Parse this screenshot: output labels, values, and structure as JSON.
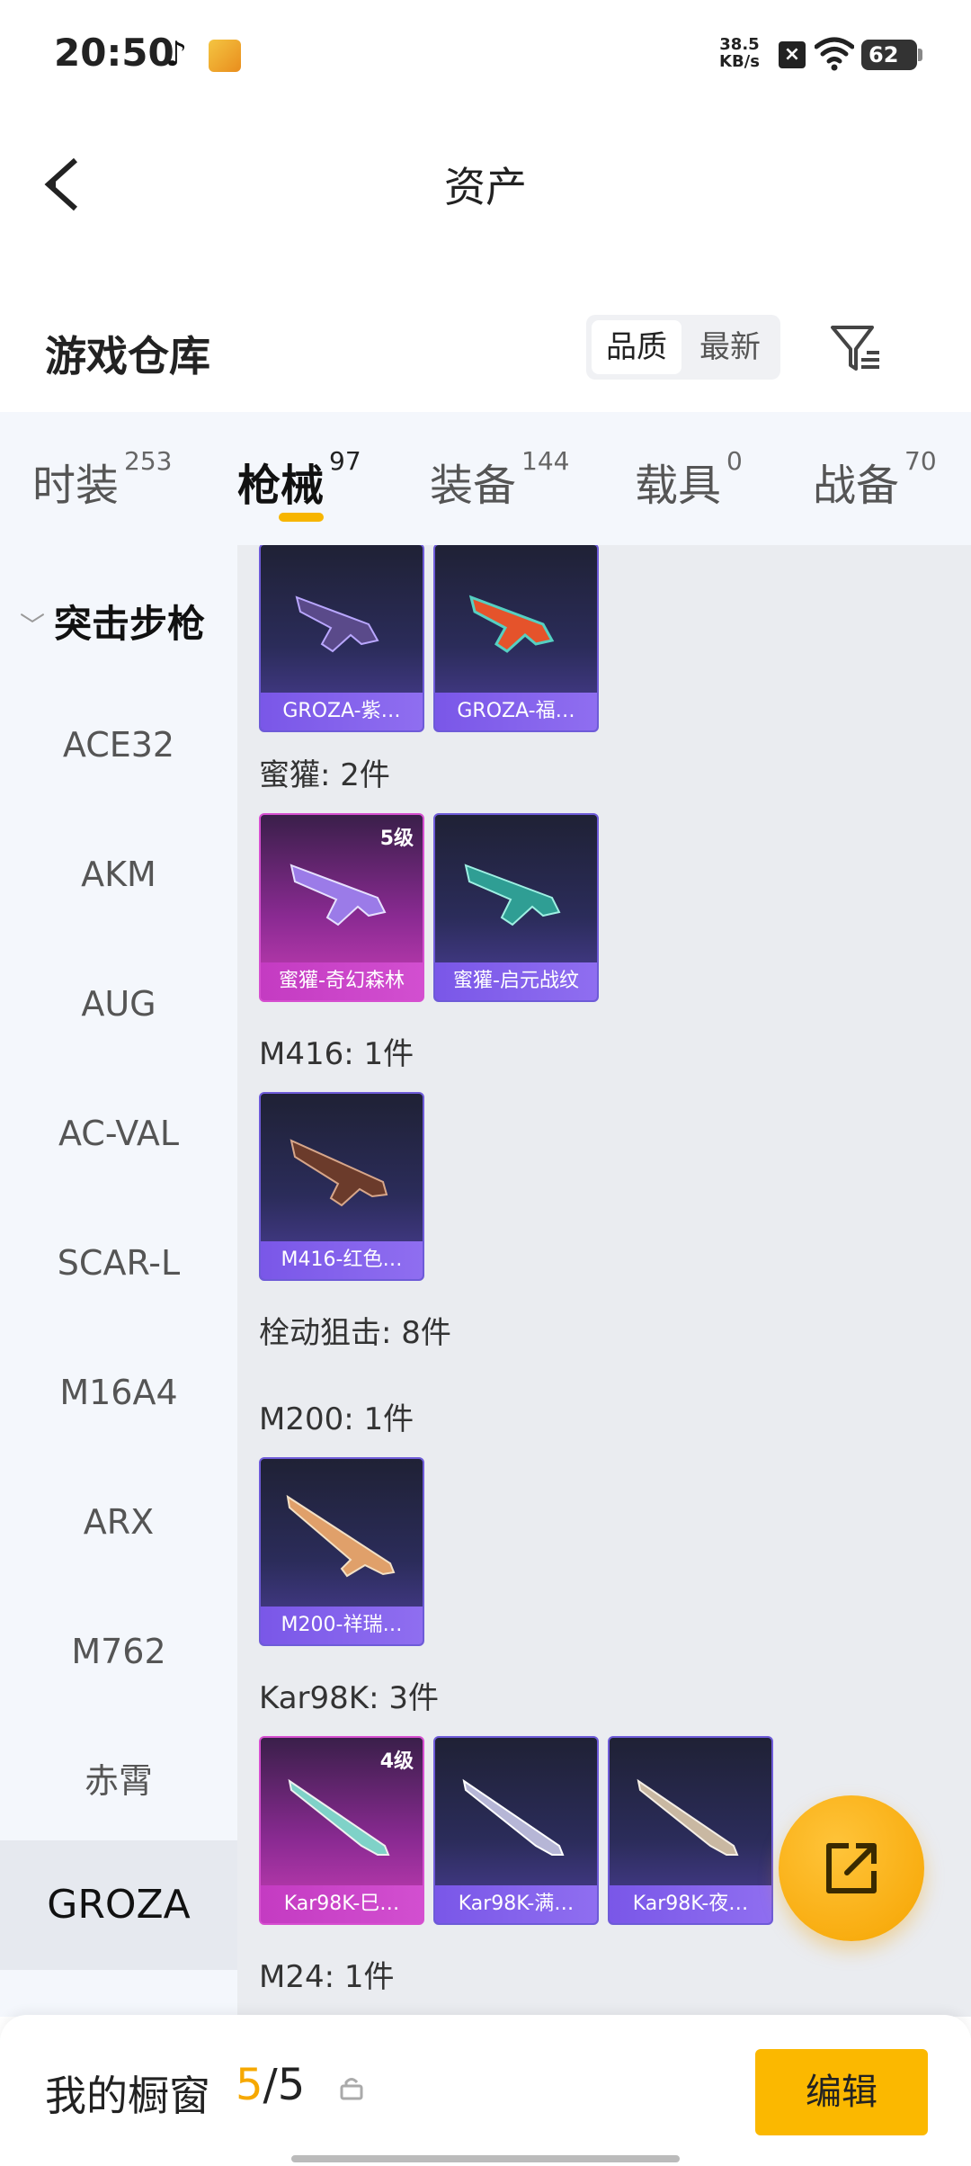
{
  "status": {
    "time": "20:50",
    "net_speed_value": "38.5",
    "net_speed_unit": "KB/s",
    "battery": "62"
  },
  "header": {
    "title": "资产"
  },
  "warehouse": {
    "title": "游戏仓库",
    "sort_options": [
      "品质",
      "最新"
    ]
  },
  "tabs": [
    {
      "label": "时装",
      "count": "253"
    },
    {
      "label": "枪械",
      "count": "97"
    },
    {
      "label": "装备",
      "count": "144"
    },
    {
      "label": "载具",
      "count": "0"
    },
    {
      "label": "战备",
      "count": "70"
    }
  ],
  "sidebar": {
    "group": "突击步枪",
    "items": [
      "ACE32",
      "AKM",
      "AUG",
      "AC-VAL",
      "SCAR-L",
      "M16A4",
      "ARX",
      "M762",
      "赤霄",
      "GROZA"
    ],
    "selected": "GROZA"
  },
  "content": {
    "sections": [
      {
        "title": "",
        "cards": [
          {
            "name": "GROZA-紫…",
            "level": "",
            "rarity": "purple"
          },
          {
            "name": "GROZA-福…",
            "level": "",
            "rarity": "purple"
          }
        ]
      },
      {
        "title": "蜜獾: 2件",
        "cards": [
          {
            "name": "蜜獾-奇幻森林",
            "level": "5级",
            "rarity": "pink"
          },
          {
            "name": "蜜獾-启元战纹",
            "level": "",
            "rarity": "purple"
          }
        ]
      },
      {
        "title": "M416: 1件",
        "cards": [
          {
            "name": "M416-红色…",
            "level": "",
            "rarity": "purple"
          }
        ]
      },
      {
        "title": "栓动狙击: 8件",
        "cards": []
      },
      {
        "title": "M200: 1件",
        "cards": [
          {
            "name": "M200-祥瑞…",
            "level": "",
            "rarity": "purple"
          }
        ]
      },
      {
        "title": "Kar98K: 3件",
        "cards": [
          {
            "name": "Kar98K-巳…",
            "level": "4级",
            "rarity": "pink"
          },
          {
            "name": "Kar98K-满…",
            "level": "",
            "rarity": "purple"
          },
          {
            "name": "Kar98K-夜…",
            "level": "",
            "rarity": "purple"
          }
        ]
      },
      {
        "title": "M24: 1件",
        "cards": []
      }
    ]
  },
  "showcase": {
    "label": "我的橱窗",
    "current": "5",
    "separator": "/",
    "total": "5",
    "edit_label": "编辑"
  },
  "colors": {
    "accent": "#f6a800",
    "purple_card": "#6e5bd8",
    "pink_card": "#d64fd0"
  }
}
